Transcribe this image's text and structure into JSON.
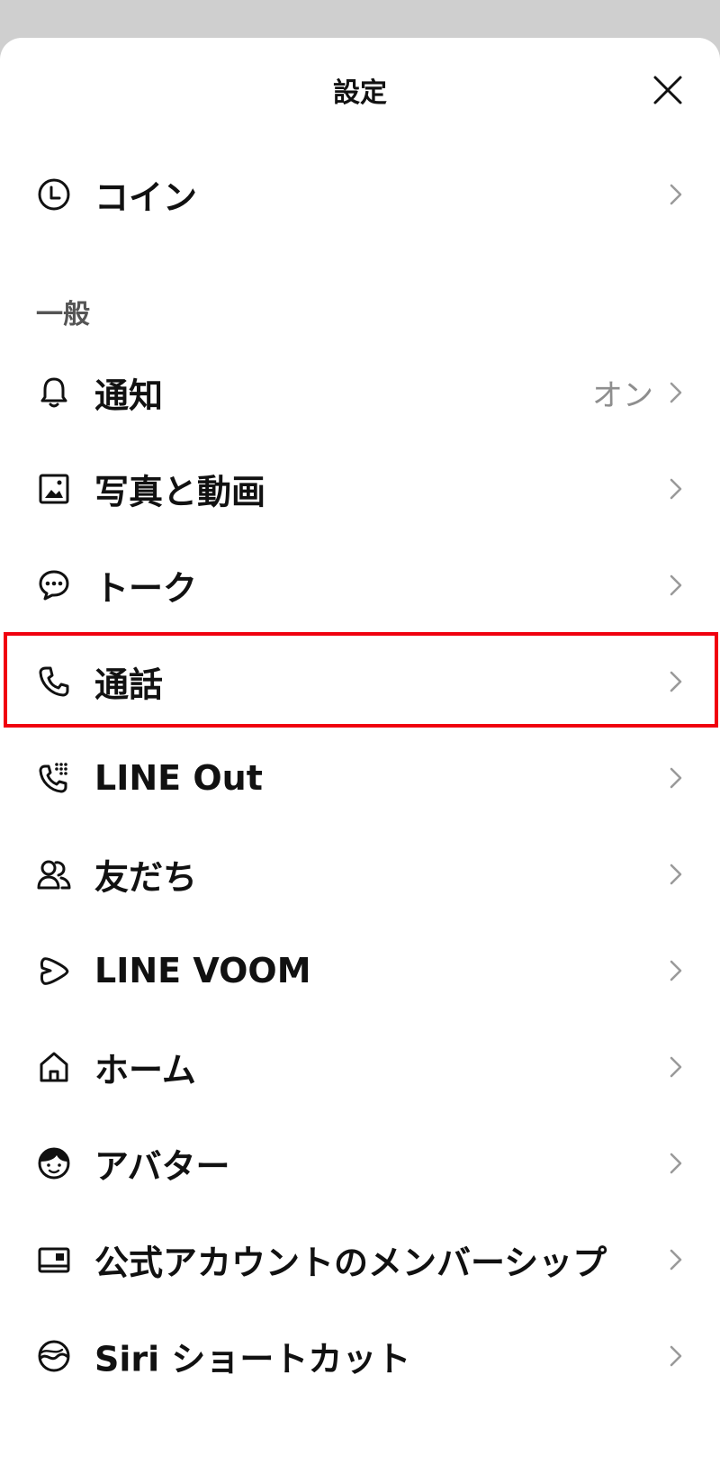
{
  "header": {
    "title": "設定"
  },
  "coin_row": {
    "label": "コイン",
    "icon": "clock-icon"
  },
  "section_general": {
    "title": "一般"
  },
  "rows": [
    {
      "key": "notifications",
      "label": "通知",
      "value": "オン",
      "icon": "bell-icon"
    },
    {
      "key": "photos-videos",
      "label": "写真と動画",
      "value": "",
      "icon": "image-icon"
    },
    {
      "key": "talk",
      "label": "トーク",
      "value": "",
      "icon": "chat-bubble-icon"
    },
    {
      "key": "calls",
      "label": "通話",
      "value": "",
      "icon": "phone-icon"
    },
    {
      "key": "line-out",
      "label": "LINE Out",
      "value": "",
      "icon": "phone-keypad-icon"
    },
    {
      "key": "friends",
      "label": "友だち",
      "value": "",
      "icon": "friends-icon"
    },
    {
      "key": "line-voom",
      "label": "LINE VOOM",
      "value": "",
      "icon": "voom-icon"
    },
    {
      "key": "home",
      "label": "ホーム",
      "value": "",
      "icon": "home-icon"
    },
    {
      "key": "avatar",
      "label": "アバター",
      "value": "",
      "icon": "avatar-face-icon"
    },
    {
      "key": "official-membership",
      "label": "公式アカウントのメンバーシップ",
      "value": "",
      "icon": "membership-card-icon"
    },
    {
      "key": "siri-shortcuts",
      "label": "Siri ショートカット",
      "value": "",
      "icon": "siri-icon"
    }
  ],
  "highlighted_row": "calls",
  "colors": {
    "highlight_border": "#f0000f",
    "value_text": "#8e8e8e",
    "chevron": "#9a9a9a",
    "backdrop": "#cfcfcf"
  }
}
